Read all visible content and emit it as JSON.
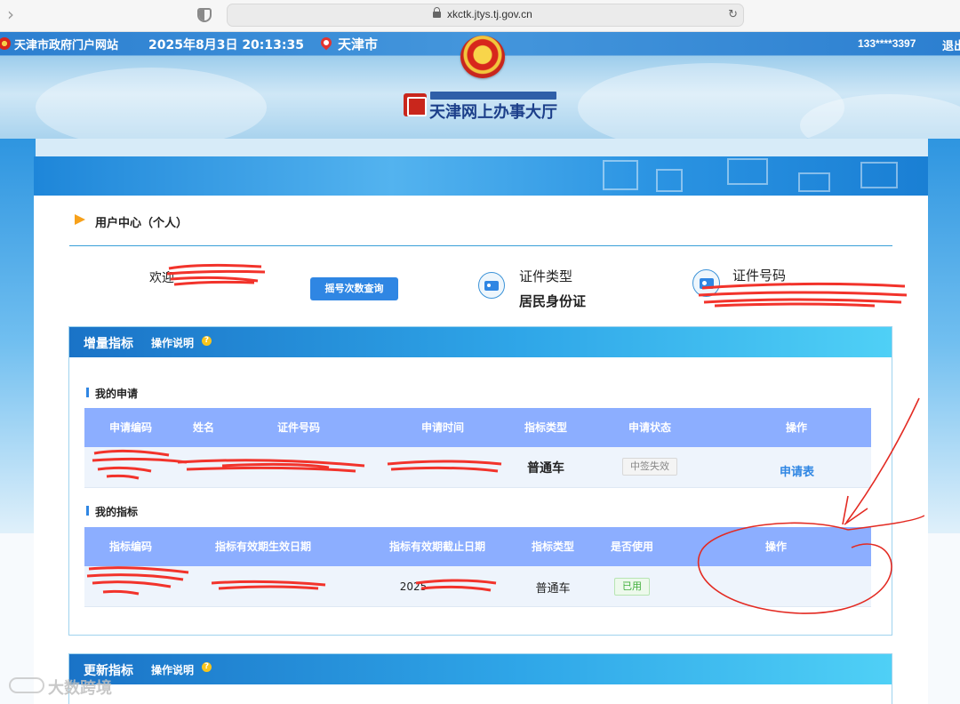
{
  "browser": {
    "url": "xkctk.jtys.tj.gov.cn"
  },
  "header": {
    "portal_link": "天津市政府门户网站",
    "datetime": "2025年8月3日 20:13:35",
    "city": "天津市",
    "user_phone": "133****3397",
    "logout": "退出",
    "site_name": "天津网上办事大厅"
  },
  "user_center": {
    "title": "用户中心（个人）",
    "welcome": "欢迎",
    "lottery_button": "摇号次数查询",
    "cert_type_label": "证件类型",
    "cert_type_value": "居民身份证",
    "cert_no_label": "证件号码"
  },
  "incremental": {
    "title": "增量指标",
    "help": "操作说明",
    "my_applications": {
      "title": "我的申请",
      "columns": [
        "申请编码",
        "姓名",
        "证件号码",
        "申请时间",
        "指标类型",
        "申请状态",
        "操作"
      ],
      "rows": [
        {
          "type": "普通车",
          "status": "中签失效",
          "action": "申请表"
        }
      ]
    },
    "my_quota": {
      "title": "我的指标",
      "columns": [
        "指标编码",
        "指标有效期生效日期",
        "指标有效期截止日期",
        "指标类型",
        "是否使用",
        "操作"
      ],
      "rows": [
        {
          "end_date_prefix": "2025",
          "type": "普通车",
          "used": "已用"
        }
      ]
    }
  },
  "update": {
    "title": "更新指标",
    "help": "操作说明"
  },
  "watermark": "大数跨境",
  "colors": {
    "header_blue": "#2c7fd0",
    "table_head": "#8caeff",
    "accent": "#2f86e3",
    "redaction": "#f2332b"
  }
}
